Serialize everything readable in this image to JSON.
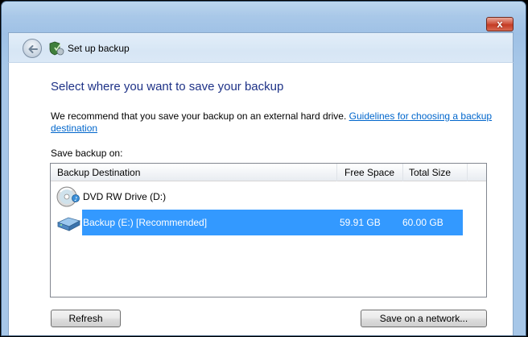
{
  "window": {
    "title": "Set up backup",
    "close_label": "x",
    "colors": {
      "frame": "#a9c8e8",
      "close": "#c43b24",
      "selection": "#3399ff",
      "heading": "#1e3287",
      "link": "#0066cc"
    }
  },
  "nav": {
    "back_icon": "back-arrow-icon",
    "app_icon": "backup-shield-icon"
  },
  "main": {
    "heading": "Select where you want to save your backup",
    "intro_text": "We recommend that you save your backup on an external hard drive. ",
    "intro_link": "Guidelines for choosing a backup destination",
    "save_on_label": "Save backup on:"
  },
  "list": {
    "columns": [
      "Backup Destination",
      "Free Space",
      "Total Size"
    ],
    "rows": [
      {
        "name": "DVD RW Drive (D:)",
        "free": "",
        "total": "",
        "icon": "dvd-drive-icon",
        "selected": false
      },
      {
        "name": "Backup (E:) [Recommended]",
        "free": "59.91 GB",
        "total": "60.00 GB",
        "icon": "hard-drive-icon",
        "selected": true
      }
    ]
  },
  "buttons": {
    "refresh": "Refresh",
    "save_network": "Save on a network..."
  }
}
